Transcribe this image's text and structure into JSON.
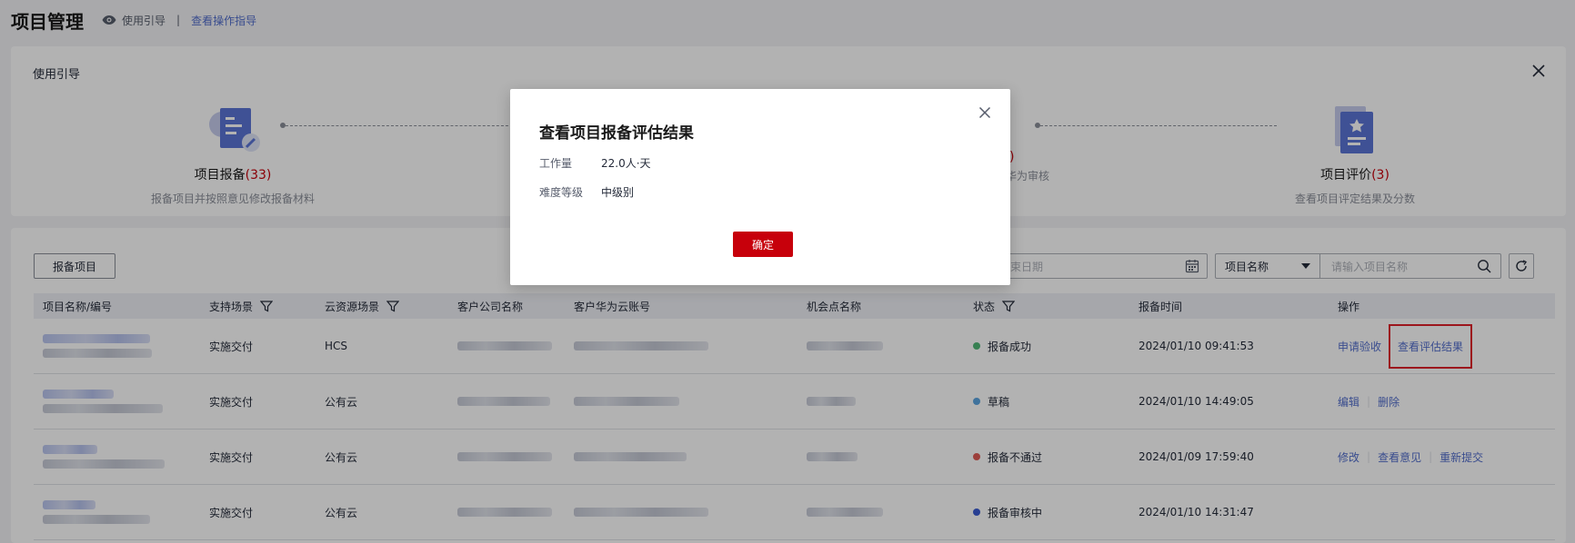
{
  "header": {
    "title": "项目管理",
    "guide_label": "使用引导",
    "separator": "|",
    "view_guide_link": "查看操作指导"
  },
  "guide": {
    "title": "使用引导",
    "steps": [
      {
        "name": "项目报备",
        "count": "(33)",
        "desc": "报备项目并按照意见修改报备材料",
        "icon": "report-doc-icon"
      },
      {
        "name": "",
        "count": "",
        "desc": "",
        "icon": ""
      },
      {
        "name": "",
        "count": "",
        "desc": "",
        "icon": ""
      },
      {
        "name": "项目评价",
        "count": "(3)",
        "desc": "查看项目评定结果及分数",
        "icon": "evaluation-doc-icon"
      }
    ],
    "partial_count": ")",
    "partial_desc": "华为审核"
  },
  "toolbar": {
    "report_button": "报备项目",
    "end_date_placeholder": "束日期",
    "filter_select": "项目名称",
    "search_placeholder": "请输入项目名称"
  },
  "table": {
    "headers": [
      "项目名称/编号",
      "支持场景",
      "云资源场景",
      "客户公司名称",
      "客户华为云账号",
      "机会点名称",
      "状态",
      "报备时间",
      "操作"
    ],
    "rows": [
      {
        "scene": "实施交付",
        "cloud": "HCS",
        "status": "报备成功",
        "status_color": "#50b876",
        "time": "2024/01/10 09:41:53",
        "ops": [
          "申请验收",
          "查看评估结果"
        ]
      },
      {
        "scene": "实施交付",
        "cloud": "公有云",
        "status": "草稿",
        "status_color": "#5ba4e0",
        "time": "2024/01/10 14:49:05",
        "ops": [
          "编辑",
          "删除"
        ]
      },
      {
        "scene": "实施交付",
        "cloud": "公有云",
        "status": "报备不通过",
        "status_color": "#e05b55",
        "time": "2024/01/09 17:59:40",
        "ops": [
          "修改",
          "查看意见",
          "重新提交"
        ]
      },
      {
        "scene": "实施交付",
        "cloud": "公有云",
        "status": "报备审核中",
        "status_color": "#3a5bd1",
        "time": "2024/01/10 14:31:47",
        "ops": []
      }
    ]
  },
  "dialog": {
    "title": "查看项目报备评估结果",
    "workload_label": "工作量",
    "workload_value": "22.0人·天",
    "level_label": "难度等级",
    "level_value": "中级别",
    "confirm": "确定"
  },
  "colors": {
    "brand_red": "#c7000b",
    "link": "#526ecc"
  }
}
